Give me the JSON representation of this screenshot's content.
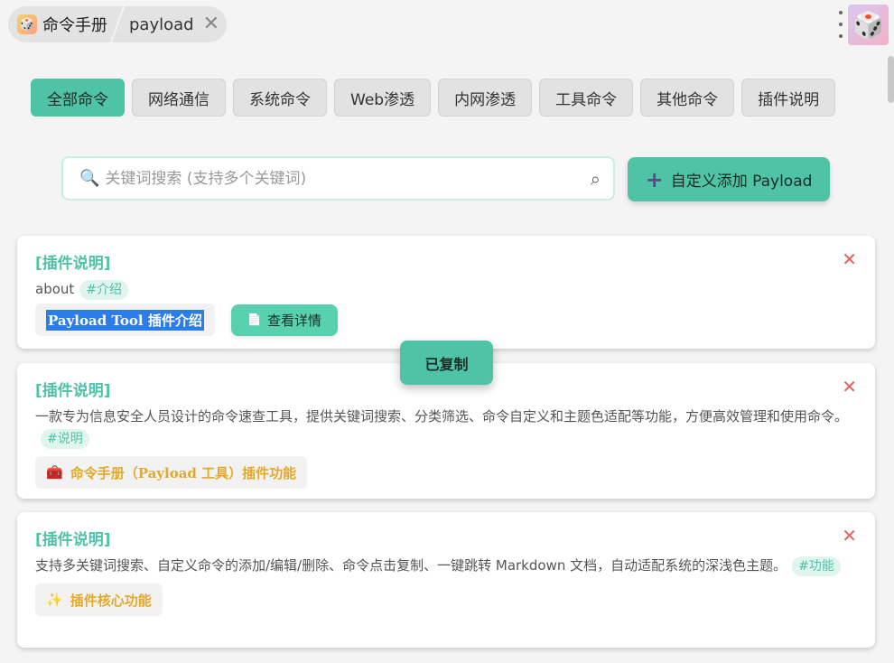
{
  "header": {
    "app_title": "命令手册",
    "tab_label": "payload",
    "close_glyph": "✕"
  },
  "categories": [
    {
      "label": "全部命令",
      "active": true
    },
    {
      "label": "网络通信",
      "active": false
    },
    {
      "label": "系统命令",
      "active": false
    },
    {
      "label": "Web渗透",
      "active": false
    },
    {
      "label": "内网渗透",
      "active": false
    },
    {
      "label": "工具命令",
      "active": false
    },
    {
      "label": "其他命令",
      "active": false
    },
    {
      "label": "插件说明",
      "active": false
    }
  ],
  "search": {
    "placeholder": "关键词搜索 (支持多个关键词)",
    "value": ""
  },
  "add_button": {
    "label": "自定义添加 Payload"
  },
  "cards": [
    {
      "category": "[插件说明]",
      "description": "about",
      "tag": "#介绍",
      "command": "Payload Tool 插件介绍",
      "detail_label": "查看详情"
    },
    {
      "category": "[插件说明]",
      "description": "一款专为信息安全人员设计的命令速查工具，提供关键词搜索、分类筛选、命令自定义和主题色适配等功能，方便高效管理和使用命令。",
      "tag": "#说明",
      "command_icon": "🧰",
      "command": "命令手册（Payload 工具）插件功能"
    },
    {
      "category": "[插件说明]",
      "description": "支持多关键词搜索、自定义命令的添加/编辑/删除、命令点击复制、一键跳转 Markdown 文档，自动适配系统的深浅色主题。",
      "tag": "#功能",
      "command_icon": "✨",
      "command": "插件核心功能"
    }
  ],
  "toast": {
    "message": "已复制"
  },
  "colors": {
    "accent": "#4ec3a6",
    "delete": "#e8605c",
    "gold": "#e3a92a",
    "selection": "#2b7de9"
  }
}
